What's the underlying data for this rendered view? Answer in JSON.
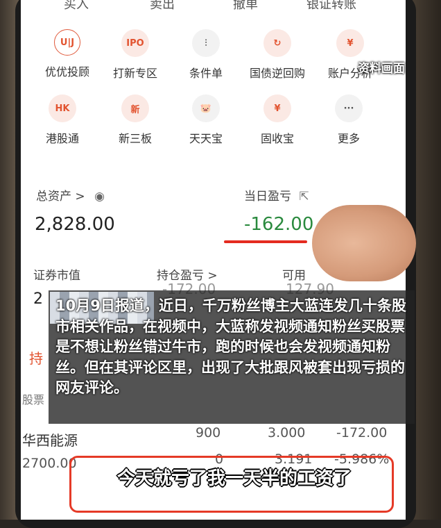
{
  "tabs": [
    "买入",
    "卖出",
    "撤单",
    "银证转账"
  ],
  "grid_row1": [
    {
      "icon": "U|J",
      "label": "优优投顾"
    },
    {
      "icon": "IPO",
      "label": "打新专区"
    },
    {
      "icon": "⫶",
      "label": "条件单"
    },
    {
      "icon": "↻",
      "label": "国债逆回购"
    },
    {
      "icon": "¥",
      "label": "账户分析"
    }
  ],
  "grid_row2": [
    {
      "icon": "HK",
      "label": "港股通"
    },
    {
      "icon": "新",
      "label": "新三板"
    },
    {
      "icon": "🐷",
      "label": "天天宝"
    },
    {
      "icon": "¥",
      "label": "固收宝"
    },
    {
      "icon": "···",
      "label": "更多"
    }
  ],
  "assets": {
    "total_label": "总资产 >",
    "total_value": "2,828.00",
    "daily_label": "当日盈亏",
    "daily_value": "-162.00",
    "market_label": "证券市值",
    "position_pl_label": "持仓盈亏 >",
    "available_label": "可用",
    "market_value": "2",
    "position_pl_value": "-172.00",
    "available_value": "127.90"
  },
  "holdings": {
    "section_prefix": "持",
    "header_prefix": "股票",
    "row_name": "华西能源",
    "row_qty": "900",
    "row_price": "3.000",
    "row_pl": "-172.00",
    "row_mv": "2700.00",
    "row_avail": "0",
    "row_cost": "3.191",
    "row_pct": "-5.986%"
  },
  "watermark": "资料画面",
  "news": "10月9日报道，近日，千万粉丝博主大蓝连发几十条股市相关作品，在视频中，大蓝称发视频通知粉丝买股票是不想让粉丝错过牛市，跑的时候也会发视频通知粉丝。但在其评论区里，出现了大批跟风被套出现亏损的网友评论。",
  "caption": "今天就亏了我一天半的工资了"
}
